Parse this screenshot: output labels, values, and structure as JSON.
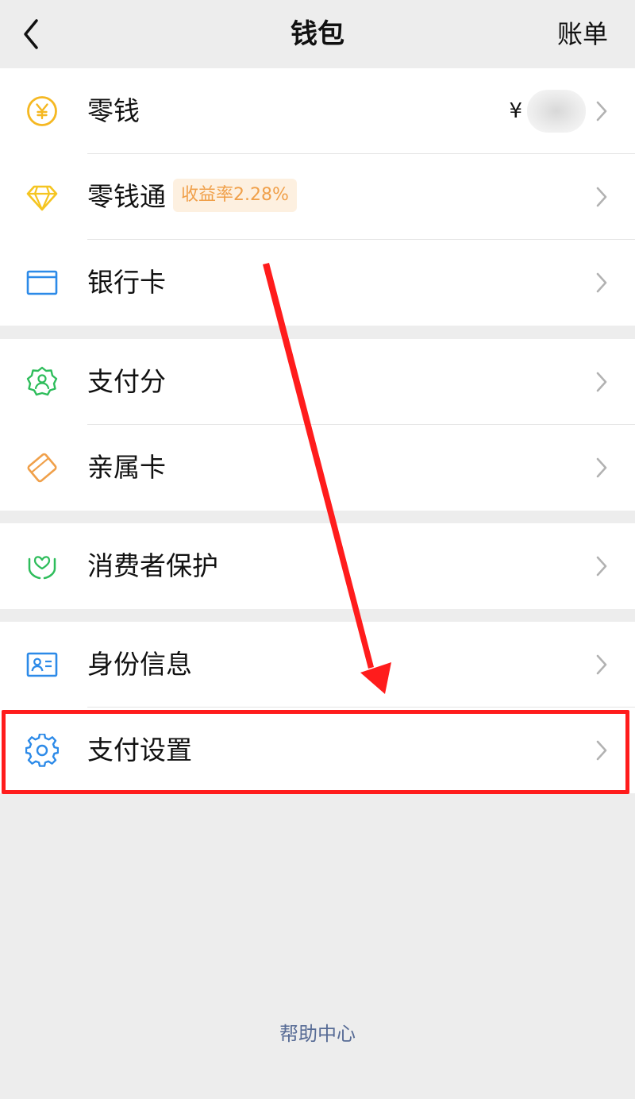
{
  "navbar": {
    "title": "钱包",
    "action_label": "账单"
  },
  "groups": [
    {
      "items": [
        {
          "label": "零钱",
          "icon": "yen-coin-icon",
          "balance_currency": "¥",
          "balance_value_hidden": true
        },
        {
          "label": "零钱通",
          "icon": "diamond-icon",
          "badge": "收益率2.28%"
        },
        {
          "label": "银行卡",
          "icon": "bank-card-icon"
        }
      ]
    },
    {
      "items": [
        {
          "label": "支付分",
          "icon": "pay-score-icon"
        },
        {
          "label": "亲属卡",
          "icon": "family-card-icon"
        }
      ]
    },
    {
      "items": [
        {
          "label": "消费者保护",
          "icon": "consumer-protection-icon"
        }
      ]
    },
    {
      "items": [
        {
          "label": "身份信息",
          "icon": "id-card-icon"
        },
        {
          "label": "支付设置",
          "icon": "gear-icon",
          "highlighted": true
        }
      ]
    }
  ],
  "footer": {
    "help_label": "帮助中心"
  },
  "colors": {
    "background": "#ededed",
    "highlight": "#ff1c1c",
    "link": "#576b95",
    "badge_text": "#f0a04a",
    "badge_bg": "#fdf0e0"
  }
}
